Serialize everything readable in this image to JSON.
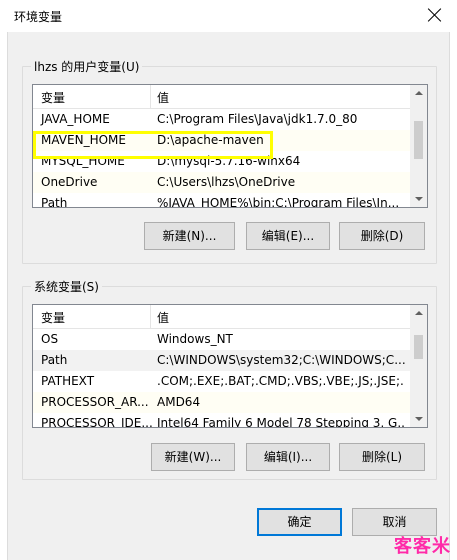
{
  "window": {
    "title": "环境变量"
  },
  "user_vars": {
    "group_label": "lhzs 的用户变量(U)",
    "columns": [
      "变量",
      "值"
    ],
    "rows": [
      {
        "name": "JAVA_HOME",
        "value": "C:\\Program Files\\Java\\jdk1.7.0_80"
      },
      {
        "name": "MAVEN_HOME",
        "value": "D:\\apache-maven"
      },
      {
        "name": "MYSQL_HOME",
        "value": "D:\\mysql-5.7.16-winx64"
      },
      {
        "name": "OneDrive",
        "value": "C:\\Users\\lhzs\\OneDrive"
      },
      {
        "name": "Path",
        "value": "%JAVA_HOME%\\bin;C:\\Program Files\\In..."
      }
    ],
    "buttons": {
      "new": "新建(N)...",
      "edit": "编辑(E)...",
      "delete": "删除(D)"
    }
  },
  "system_vars": {
    "group_label": "系统变量(S)",
    "columns": [
      "变量",
      "值"
    ],
    "rows": [
      {
        "name": "OS",
        "value": "Windows_NT"
      },
      {
        "name": "Path",
        "value": "C:\\WINDOWS\\system32;C:\\WINDOWS;C..."
      },
      {
        "name": "PATHEXT",
        "value": ".COM;.EXE;.BAT;.CMD;.VBS;.VBE;.JS;.JSE;..."
      },
      {
        "name": "PROCESSOR_AR...",
        "value": "AMD64"
      },
      {
        "name": "PROCESSOR_IDE...",
        "value": "Intel64 Family 6 Model 78 Stepping 3, G..."
      }
    ],
    "buttons": {
      "new": "新建(W)...",
      "edit": "编辑(I)...",
      "delete": "删除(L)"
    }
  },
  "footer": {
    "ok": "确定",
    "cancel": "取消"
  },
  "watermark": "客客米",
  "colors": {
    "highlight": "#ffff00",
    "default_button_border": "#0078d7",
    "watermark": "#ff2aa8"
  }
}
